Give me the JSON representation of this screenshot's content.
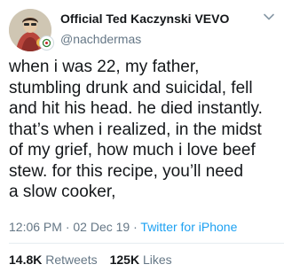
{
  "author": {
    "display_name": "Official Ted Kaczynski VEVO",
    "handle": "@nachdermas"
  },
  "tweet": {
    "lines": [
      "when i was 22, my father,",
      "stumbling drunk and suicidal, fell",
      "and hit his head. he died instantly.",
      "that’s when i realized, in the midst",
      "of my grief, how much i love beef",
      "stew. for this recipe, you’ll need",
      "a slow cooker,"
    ],
    "time": "12:06 PM",
    "date": "02 Dec 19",
    "separator": "·",
    "source": "Twitter for iPhone"
  },
  "stats": {
    "retweets_count": "14.8K",
    "retweets_label": "Retweets",
    "likes_count": "125K",
    "likes_label": "Likes"
  },
  "icons": {
    "menu": "chevron-down-icon",
    "avatar": "avatar",
    "badge": "badge-icon"
  },
  "colors": {
    "link": "#1da1f2",
    "secondary_text": "#657786",
    "primary_text": "#14171a"
  }
}
